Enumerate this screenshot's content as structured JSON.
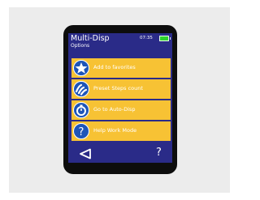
{
  "header": {
    "title": "Multi-Disp",
    "subtitle": "Options",
    "time": "07:35"
  },
  "menu": {
    "items": [
      {
        "label": "Add to favorites",
        "icon": "star-icon"
      },
      {
        "label": "Preset Steps count",
        "icon": "steps-icon"
      },
      {
        "label": "Go to Auto-Disp",
        "icon": "stopwatch-icon"
      },
      {
        "label": "Help Work Mode",
        "icon": "help-icon"
      }
    ]
  },
  "footer": {
    "back_icon": "back-triangle-icon",
    "help_label": "?"
  },
  "colors": {
    "screen_bg": "#2a2b88",
    "menu_item_bg": "#f7c234",
    "icon_bg": "#1e55b8",
    "battery": "#2dd22d"
  }
}
